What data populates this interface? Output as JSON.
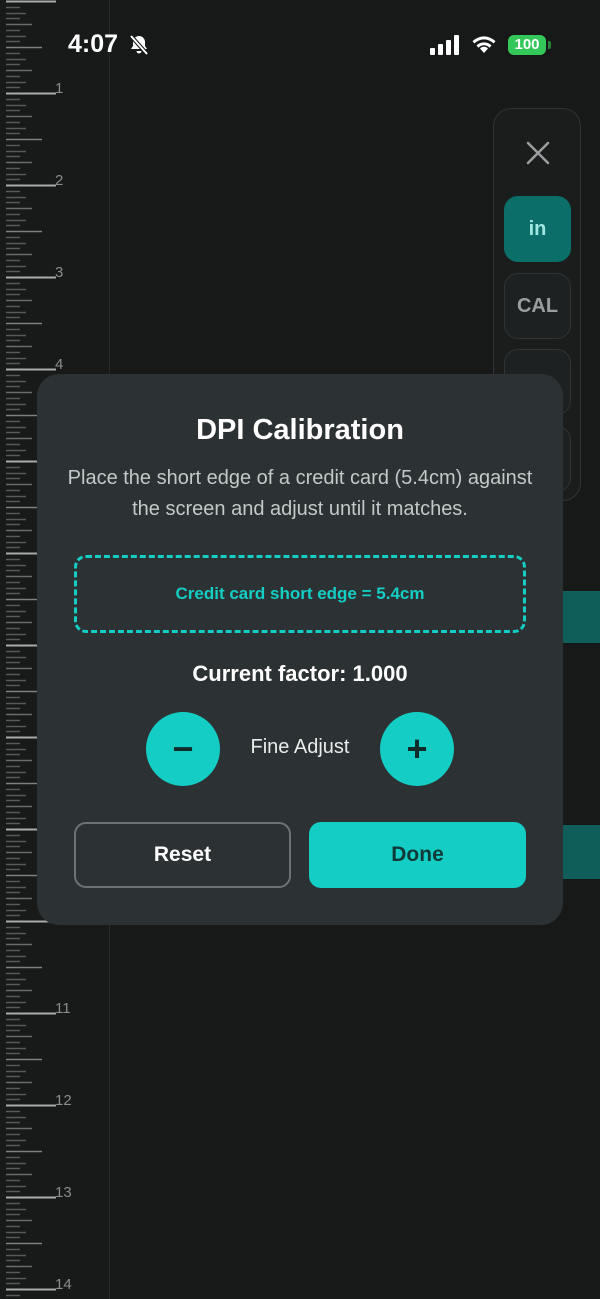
{
  "status_bar": {
    "time": "4:07",
    "battery": "100",
    "icons": [
      "bell-slash-icon",
      "cellular-signal-icon",
      "wifi-icon",
      "battery-icon"
    ]
  },
  "ruler": {
    "labels": [
      "1",
      "2",
      "3",
      "4",
      "11",
      "12",
      "13",
      "14"
    ]
  },
  "toolbar": {
    "close_icon": "close-icon",
    "unit_label": "in",
    "calibrate_label": "CAL"
  },
  "modal": {
    "title": "DPI Calibration",
    "description": "Place the short edge of a credit card (5.4cm) against the screen and adjust until it matches.",
    "reference_label": "Credit card short edge = 5.4cm",
    "factor_text": "Current factor: 1.000",
    "fine_adjust_label": "Fine Adjust",
    "minus_label": "−",
    "plus_label": "+",
    "reset_label": "Reset",
    "done_label": "Done"
  },
  "colors": {
    "accent": "#14cdc4",
    "background": "#171818",
    "modal": "#2c3233",
    "active_tool": "#0b6e68"
  }
}
